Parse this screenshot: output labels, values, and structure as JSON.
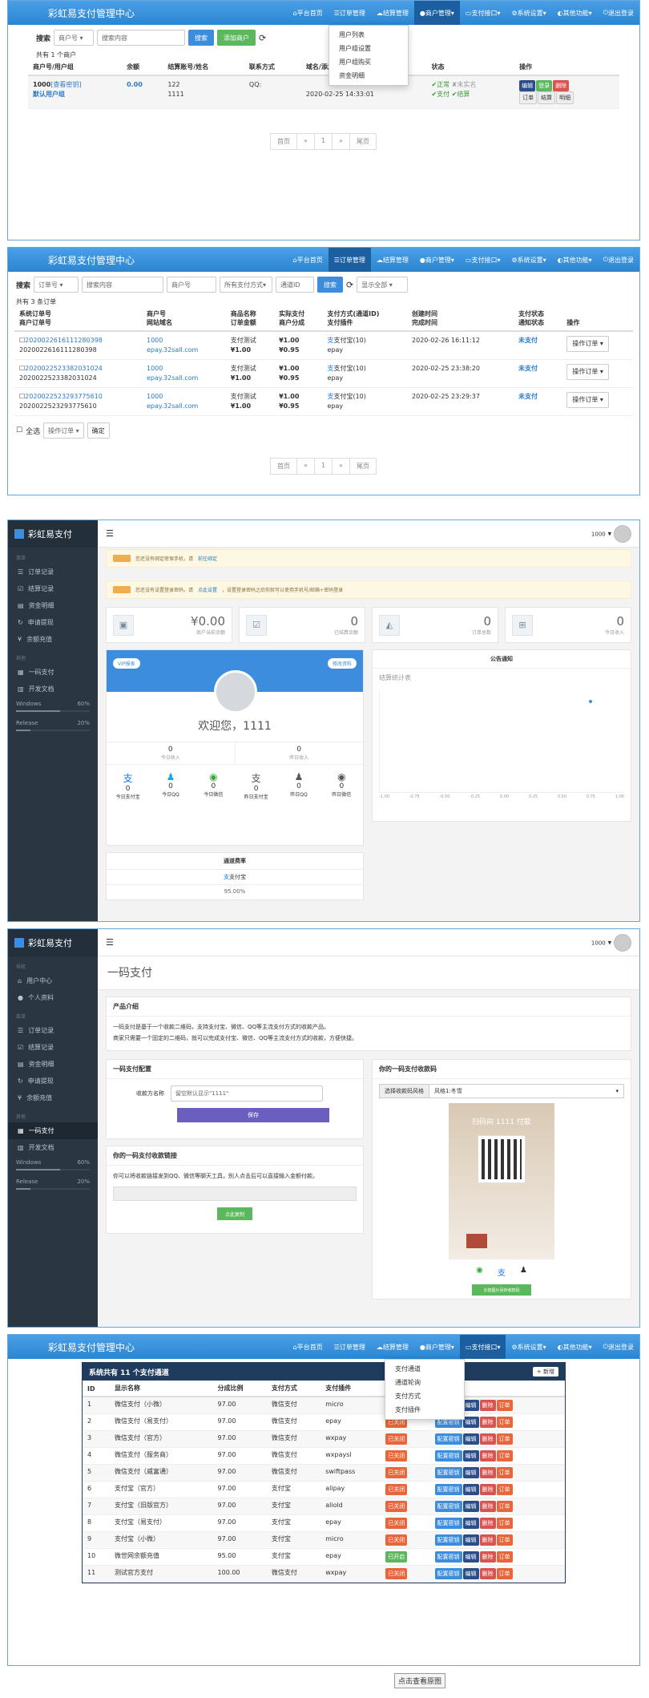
{
  "nav": {
    "brand": "彩虹易支付管理中心",
    "items": [
      "平台首页",
      "订单管理",
      "结算管理",
      "商户管理",
      "支付接口",
      "系统设置",
      "其他功能",
      "退出登录"
    ]
  },
  "p1": {
    "dropdown": [
      "用户列表",
      "用户组设置",
      "用户组购买",
      "资金明细"
    ],
    "search_label": "搜索",
    "search_select": "商户号",
    "search_placeholder": "搜索内容",
    "search_btn": "搜索",
    "add_btn": "添加商户",
    "count": "共有 1 个商户",
    "headers": [
      "商户号/用户组",
      "余额",
      "结算账号/姓名",
      "联系方式",
      "域名/添加时间",
      "状态",
      "操作"
    ],
    "row": {
      "id": "1000",
      "view_key": "[查看密钥]",
      "group": "默认用户组",
      "balance": "0.00",
      "account": "122",
      "name": "1111",
      "contact": "QQ:",
      "time": "2020-02-25 14:33:01",
      "s1": "✔正常",
      "s2": "✘未实名",
      "s3": "✔支付",
      "s4": "✔结算",
      "ops1": [
        "编辑",
        "登录",
        "删除"
      ],
      "ops2": [
        "订单",
        "结算",
        "明细"
      ]
    },
    "pager": [
      "首页",
      "«",
      "1",
      "»",
      "尾页"
    ]
  },
  "p2": {
    "search_label": "搜索",
    "select1": "订单号",
    "ph1": "搜索内容",
    "ph2": "商户号",
    "select2": "所有支付方式",
    "ph3": "通道ID",
    "search_btn": "搜索",
    "select3": "显示全部",
    "count": "共有 3 条订单",
    "headers": [
      [
        "系统订单号",
        "商户订单号"
      ],
      [
        "商户号",
        "网站域名"
      ],
      [
        "商品名称",
        "订单金额"
      ],
      [
        "实际支付",
        "商户分成"
      ],
      [
        "支付方式(通道ID)",
        "支付插件"
      ],
      [
        "创建时间",
        "完成时间"
      ],
      [
        "支付状态",
        "通知状态"
      ],
      [
        "操作"
      ]
    ],
    "rows": [
      {
        "tn": "2020022616111280398",
        "otn": "2020022616111280398",
        "pid": "1000",
        "site": "epay.32sall.com",
        "name": "支付测试",
        "money": "¥1.00",
        "real": "¥1.00",
        "split": "¥0.95",
        "type": "支付宝(10)",
        "plugin": "epay",
        "created": "2020-02-26 16:11:12",
        "done": "",
        "status": "未支付"
      },
      {
        "tn": "2020022523382031024",
        "otn": "2020022523382031024",
        "pid": "1000",
        "site": "epay.32sall.com",
        "name": "支付测试",
        "money": "¥1.00",
        "real": "¥1.00",
        "split": "¥0.95",
        "type": "支付宝(10)",
        "plugin": "epay",
        "created": "2020-02-25 23:38:20",
        "done": "",
        "status": "未支付"
      },
      {
        "tn": "2020022523293775610",
        "otn": "2020022523293775610",
        "pid": "1000",
        "site": "epay.32sall.com",
        "name": "支付测试",
        "money": "¥1.00",
        "real": "¥1.00",
        "split": "¥0.95",
        "type": "支付宝(10)",
        "plugin": "epay",
        "created": "2020-02-25 23:29:37",
        "done": "",
        "status": "未支付"
      }
    ],
    "op_btn": "操作订单 ▾",
    "select_all": "全选",
    "op_select": "操作订单 ▾",
    "confirm": "确定",
    "pager": [
      "首页",
      "«",
      "1",
      "»",
      "尾页"
    ]
  },
  "p3": {
    "brand": "彩虹易支付",
    "user": "1000",
    "menu_sec1": "菜单",
    "menu": [
      "订单记录",
      "结算记录",
      "资金明细",
      "申请提现",
      "余额充值"
    ],
    "menu_sec2": "其他",
    "menu2": [
      "一码支付",
      "开发文档"
    ],
    "bars": [
      {
        "l": "Windows",
        "v": "60%"
      },
      {
        "l": "Release",
        "v": "20%"
      }
    ],
    "warn1": "您还没有绑定密保手机，请",
    "warn1_link": "前往绑定",
    "warn2": "您还没有设置登录密码，请",
    "warn2_link": "点此设置",
    "warn2_tail": "，设置登录密码之后你就可以使用手机号/邮箱+密码登录",
    "stats": [
      {
        "v": "¥0.00",
        "s": "商户当前余额"
      },
      {
        "v": "0",
        "s": "已结算余额"
      },
      {
        "v": "0",
        "s": "订单总数"
      },
      {
        "v": "0",
        "s": "今日收入"
      }
    ],
    "btn_vip": "VIP报表",
    "btn_edit": "修改资料",
    "welcome": "欢迎您，1111",
    "mini": [
      {
        "v": "0",
        "s": "今日收入"
      },
      {
        "v": "0",
        "s": "昨日收入"
      }
    ],
    "icons": [
      {
        "v": "0",
        "s": "今日支付宝"
      },
      {
        "v": "0",
        "s": "今日QQ"
      },
      {
        "v": "0",
        "s": "今日微信"
      },
      {
        "v": "0",
        "s": "昨日支付宝"
      },
      {
        "v": "0",
        "s": "昨日QQ"
      },
      {
        "v": "0",
        "s": "昨日微信"
      }
    ],
    "rate_title": "通道费率",
    "rate_name": "支付宝",
    "rate_val": "95.00%",
    "notice_title": "公告通知",
    "chart_title": "结算统计表",
    "chart_x": [
      "-1.00",
      "-0.75",
      "-0.50",
      "-0.25",
      "0.00",
      "0.25",
      "0.50",
      "0.75",
      "1.00"
    ]
  },
  "p4": {
    "brand": "彩虹易支付",
    "user": "1000",
    "page_title": "一码支付",
    "menu_sec0": "导航",
    "menu0": [
      "用户中心",
      "个人资料"
    ],
    "menu_sec1": "菜单",
    "menu": [
      "订单记录",
      "结算记录",
      "资金明细",
      "申请提现",
      "余额充值"
    ],
    "menu_sec2": "其他",
    "menu2": [
      "一码支付",
      "开发文档"
    ],
    "bars": [
      {
        "l": "Windows",
        "v": "60%"
      },
      {
        "l": "Release",
        "v": "20%"
      }
    ],
    "intro_title": "产品介绍",
    "intro1": "一码支付是基于一个收款二维码，支持支付宝、微信、QQ等主流支付方式的收款产品。",
    "intro2": "商家只需要一个固定的二维码，就可以完成支付宝、微信、QQ等主流支付方式的收款，方便快捷。",
    "cfg_title": "一码支付配置",
    "cfg_label": "收款方名称",
    "cfg_ph": "留空默认显示\"1111\"",
    "cfg_btn": "保存",
    "link_title": "你的一码支付收款链接",
    "link_desc": "你可以将收款链接发到QQ、微信等聊天工具，别人点击后可以直接输入金额付款。",
    "link_btn": "点此复制",
    "qr_title": "你的一码支付收款码",
    "qr_style_label": "选择收款码风格",
    "qr_style": "风格1:冬雪",
    "qr_text": "扫码向 1111 付款",
    "qr_btn": "长按图片另存收款码"
  },
  "p5": {
    "dropdown": [
      "支付通道",
      "通道轮询",
      "支付方式",
      "支付插件"
    ],
    "title": "系统共有 11 个支付通道",
    "add_btn": "+ 新增",
    "headers": [
      "ID",
      "显示名称",
      "分成比例",
      "支付方式",
      "支付插件",
      "状态",
      "操作"
    ],
    "rows": [
      {
        "id": "1",
        "name": "微信支付（小微）",
        "rate": "97.00",
        "type": "微信支付",
        "plugin": "micro",
        "status": "已关闭"
      },
      {
        "id": "2",
        "name": "微信支付（易支付）",
        "rate": "97.00",
        "type": "微信支付",
        "plugin": "epay",
        "status": "已关闭"
      },
      {
        "id": "3",
        "name": "微信支付（官方）",
        "rate": "97.00",
        "type": "微信支付",
        "plugin": "wxpay",
        "status": "已关闭"
      },
      {
        "id": "4",
        "name": "微信支付（服务商）",
        "rate": "97.00",
        "type": "微信支付",
        "plugin": "wxpaysl",
        "status": "已关闭"
      },
      {
        "id": "5",
        "name": "微信支付（威富通）",
        "rate": "97.00",
        "type": "微信支付",
        "plugin": "swiftpass",
        "status": "已关闭"
      },
      {
        "id": "6",
        "name": "支付宝（官方）",
        "rate": "97.00",
        "type": "支付宝",
        "plugin": "alipay",
        "status": "已关闭"
      },
      {
        "id": "7",
        "name": "支付宝（旧版官方）",
        "rate": "97.00",
        "type": "支付宝",
        "plugin": "aliold",
        "status": "已关闭"
      },
      {
        "id": "8",
        "name": "支付宝（易支付）",
        "rate": "97.00",
        "type": "支付宝",
        "plugin": "epay",
        "status": "已关闭"
      },
      {
        "id": "9",
        "name": "支付宝（小微）",
        "rate": "97.00",
        "type": "支付宝",
        "plugin": "micro",
        "status": "已关闭"
      },
      {
        "id": "10",
        "name": "微世网余额充值",
        "rate": "95.00",
        "type": "支付宝",
        "plugin": "epay",
        "status": "已开启"
      },
      {
        "id": "11",
        "name": "测试官方支付",
        "rate": "100.00",
        "type": "微信支付",
        "plugin": "wxpay",
        "status": "已关闭"
      }
    ],
    "ops": [
      "配置密钥",
      "编辑",
      "删除",
      "订单"
    ],
    "footer": "点击查看原图"
  }
}
